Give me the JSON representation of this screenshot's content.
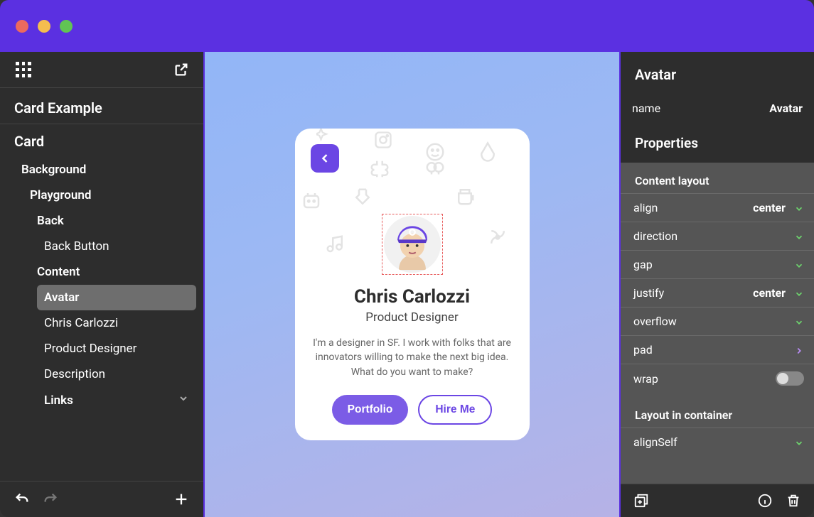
{
  "left": {
    "title1": "Card Example",
    "title2": "Card",
    "tree": {
      "background": "Background",
      "playground": "Playground",
      "back": "Back",
      "back_button": "Back Button",
      "content": "Content",
      "avatar": "Avatar",
      "chris": "Chris Carlozzi",
      "product_designer": "Product Designer",
      "description": "Description",
      "links": "Links"
    }
  },
  "card": {
    "name": "Chris Carlozzi",
    "role": "Product Designer",
    "desc": "I'm a designer in SF. I work with folks that are innovators willing to make the next big idea. What do you want to make?",
    "link_primary": "Portfolio",
    "link_secondary": "Hire Me"
  },
  "right": {
    "title": "Avatar",
    "name_label": "name",
    "name_value": "Avatar",
    "properties_header": "Properties",
    "content_layout_header": "Content layout",
    "layout_in_container_header": "Layout in container",
    "props": {
      "align": {
        "label": "align",
        "value": "center"
      },
      "direction": {
        "label": "direction",
        "value": ""
      },
      "gap": {
        "label": "gap",
        "value": ""
      },
      "justify": {
        "label": "justify",
        "value": "center"
      },
      "overflow": {
        "label": "overflow",
        "value": ""
      },
      "pad": {
        "label": "pad",
        "value": ""
      },
      "wrap": {
        "label": "wrap",
        "value": ""
      },
      "alignSelf": {
        "label": "alignSelf",
        "value": ""
      }
    }
  }
}
